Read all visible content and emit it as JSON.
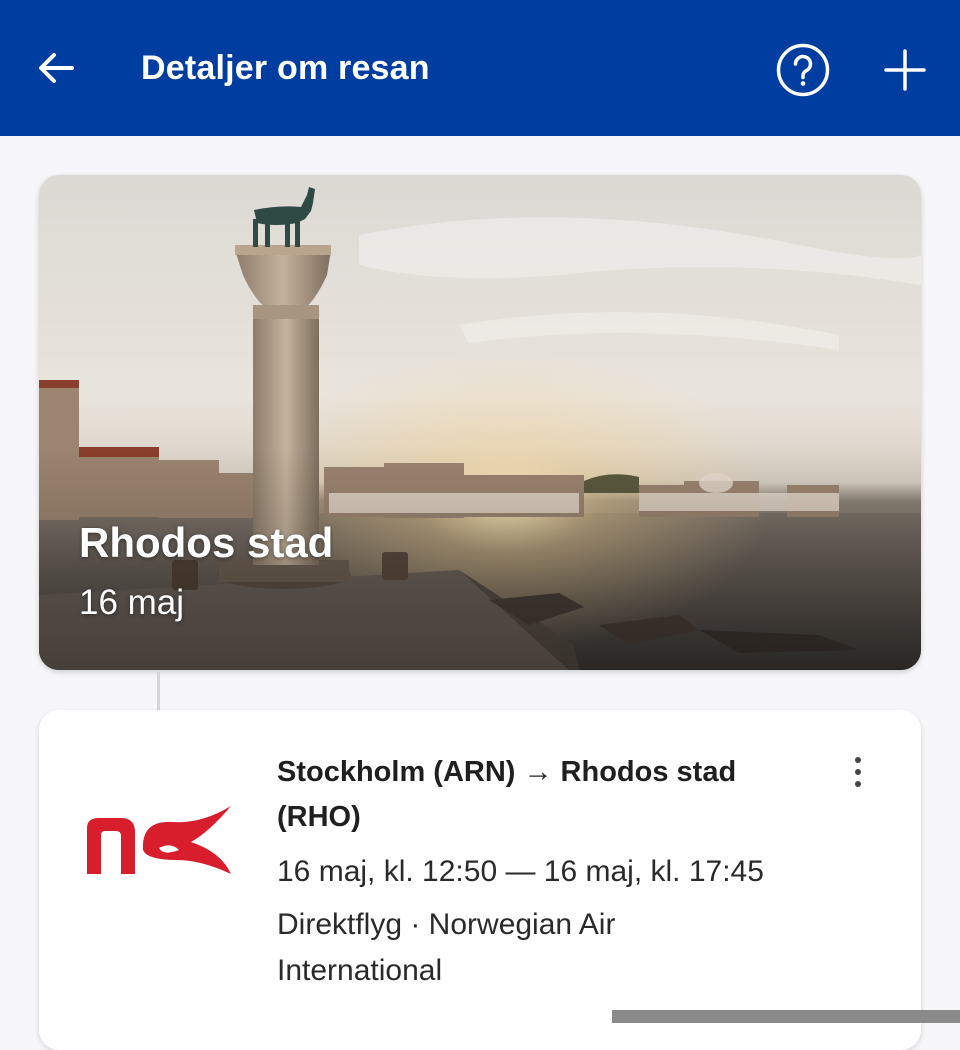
{
  "appbar": {
    "title": "Detaljer om resan",
    "back_icon": "arrow-left-icon",
    "help_icon": "help-circle-icon",
    "add_icon": "plus-icon",
    "background": "#003da1"
  },
  "destination": {
    "name": "Rhodos stad",
    "date": "16 maj",
    "image": "rhodes-harbour-deer-column-photo"
  },
  "flight": {
    "airline_logo_text": "nx",
    "route": "Stockholm (ARN) → Rhodos stad (RHO)",
    "times": "16 maj, kl. 12:50 — 16 maj, kl. 17:45",
    "info": "Direktflyg · Norwegian Air International",
    "more_icon": "more-vertical-icon",
    "logo_color": "#d81e2c"
  }
}
